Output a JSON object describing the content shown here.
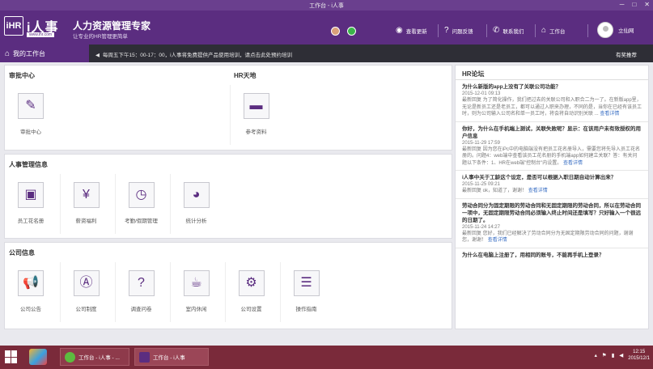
{
  "window": {
    "title": "工作台 - i人事",
    "minimize": "─",
    "maximize": "□",
    "close": "✕"
  },
  "header": {
    "logo_mark": "iHR",
    "logo_text": "i人事",
    "logo_url": "www.ihr.com",
    "brand_title": "人力资源管理专家",
    "brand_subtitle": "让专业的HR管理更简单",
    "nav": [
      {
        "label": "查看更新",
        "icon": "eye-icon"
      },
      {
        "label": "问题反馈",
        "icon": "help-icon"
      },
      {
        "label": "联系我们",
        "icon": "phone-icon"
      },
      {
        "label": "工作台",
        "icon": "home-icon"
      }
    ],
    "user_name": "立仙网"
  },
  "subbar": {
    "home_label": "我的工作台",
    "notice": "每周五下午15：00-17：00，i人事将免费提供产品使用培训，请点击此处预约培训",
    "help": "有奖推荐"
  },
  "sections": {
    "approval": {
      "title": "审批中心",
      "tiles": [
        {
          "label": "审批中心",
          "icon": "approval-icon"
        }
      ]
    },
    "hr_world": {
      "title": "HR天地",
      "tiles": [
        {
          "label": "参考资料",
          "icon": "folder-icon"
        }
      ]
    },
    "personnel": {
      "title": "人事管理信息",
      "tiles": [
        {
          "label": "员工花名册",
          "icon": "roster-icon"
        },
        {
          "label": "薪资福利",
          "icon": "money-bag-icon"
        },
        {
          "label": "考勤/假期管理",
          "icon": "clock-icon"
        },
        {
          "label": "统计分析",
          "icon": "pie-chart-icon"
        }
      ]
    },
    "company": {
      "title": "公司信息",
      "tiles": [
        {
          "label": "公司公告",
          "icon": "megaphone-icon"
        },
        {
          "label": "公司制度",
          "icon": "compass-icon"
        },
        {
          "label": "调查问卷",
          "icon": "question-icon"
        },
        {
          "label": "室内休闲",
          "icon": "coffee-icon"
        },
        {
          "label": "公司设置",
          "icon": "gear-icon"
        },
        {
          "label": "操作指南",
          "icon": "guide-icon"
        }
      ]
    }
  },
  "forum": {
    "title": "HR论坛",
    "posts": [
      {
        "title": "为什么新版的app上没有了关联公司功能？",
        "date": "2015-12-01 09:13",
        "body": "最新回复 为了简化操作，我们把过去的关联公司和入职合二为一了。在新版app里，无论是新员工还是老员工，都可以通过入职来办理，不同的是，当你在已经有该员工时，则为公司输入公司名和单一员工时，将会将自动识别关联 ...",
        "link": "查看详情"
      },
      {
        "title": "你好，为什么在手机端上测试，关联失败呢？显示：在该用户未有效授权的用户信息",
        "date": "2015-11-29 17:59",
        "body": "最新回复 因为您在iPc中的电脑端没有把员工花名册导入，需要您将先导入员工花名册的。问题4：web端中查看该员工花名册的手机端app如何建立关联？答：有关问题以下条件：1、HR在web端\"控制台\"内设置。",
        "link": "查看详情"
      },
      {
        "title": "i人事中关于工龄这个设定，是否可以根据入职日期自动计算出来？",
        "date": "2015-11-25 09:21",
        "body": "最新回复 ok，知道了，谢谢！",
        "link": "查看详情"
      },
      {
        "title": "劳动合同分为固定期限的劳动合同和无固定期限的劳动合同，所以在劳动合同一项中，无固定期限劳动合同必须输入终止时间还是填写？只好输入一个很远的日期了。",
        "date": "2015-11-24 14:27",
        "body": "最新回复 您好，我们已经解决了劳动合同分为无固定期限劳动合同的问题，谢谢您，谢谢！",
        "link": "查看详情"
      },
      {
        "title": "为什么在电脑上注册了，用相同的账号，不能再手机上登录？",
        "date": "",
        "body": "",
        "link": ""
      }
    ]
  },
  "taskbar": {
    "tasks": [
      {
        "label": "工作台 - i人事 - ..."
      },
      {
        "label": "工作台 - i人事"
      }
    ],
    "clock_time": "12:15",
    "clock_date": "2015/12/1"
  },
  "colors": {
    "brand": "#5b2d80",
    "subbar": "#2e2e36",
    "taskbar": "#7a2a3a",
    "link": "#3a6fc4"
  }
}
